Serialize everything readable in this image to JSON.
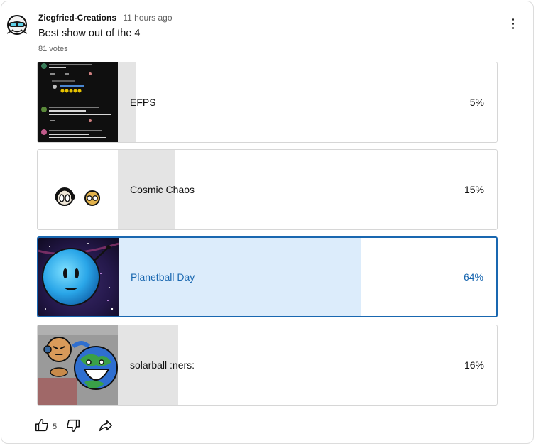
{
  "post": {
    "author": "Ziegfried-Creations",
    "time": "11 hours ago",
    "question": "Best show out of the 4",
    "votes": "81 votes"
  },
  "options": [
    {
      "label": "EFPS",
      "percent": "5%",
      "fraction": 0.05,
      "selected": false
    },
    {
      "label": "Cosmic Chaos",
      "percent": "15%",
      "fraction": 0.15,
      "selected": false
    },
    {
      "label": "Planetball Day",
      "percent": "64%",
      "fraction": 0.64,
      "selected": true
    },
    {
      "label": "solarball :ners:",
      "percent": "16%",
      "fraction": 0.16,
      "selected": false
    }
  ],
  "actions": {
    "like_count": "5",
    "icons": [
      "thumbs-up-icon",
      "thumbs-down-icon",
      "share-icon",
      "more-vert-icon"
    ]
  },
  "colors": {
    "accent": "#1967b0",
    "fill_default": "#e4e4e4",
    "fill_selected": "#dcecfb"
  }
}
